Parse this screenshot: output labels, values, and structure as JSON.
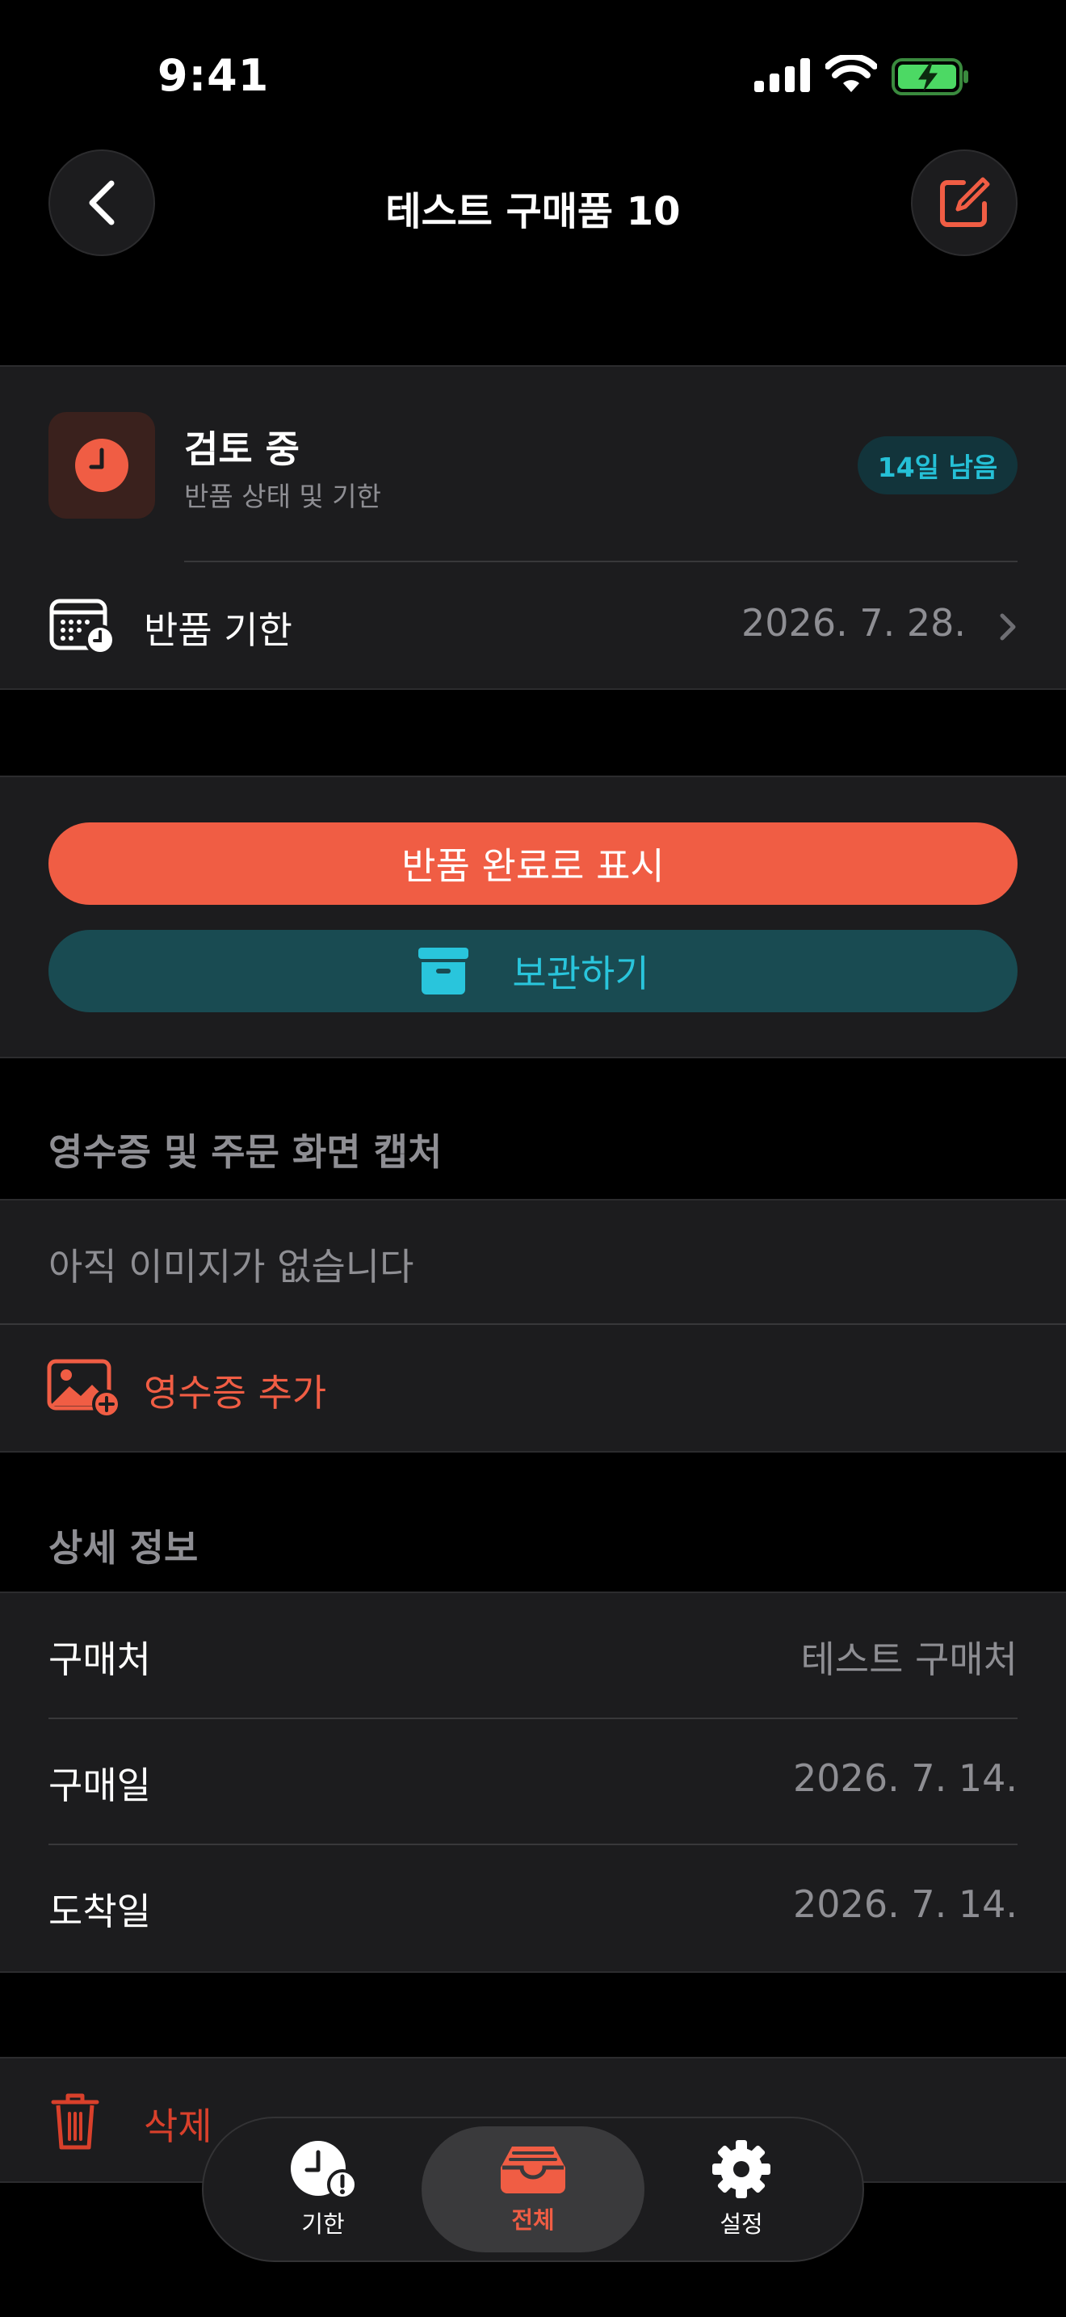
{
  "status_bar": {
    "time": "9:41"
  },
  "nav": {
    "title": "테스트 구매품 10"
  },
  "status_card": {
    "title": "검토 중",
    "subtitle": "반품 상태 및 기한",
    "badge": "14일 남음",
    "deadline_label": "반품 기한",
    "deadline_value": "2026. 7. 28."
  },
  "actions": {
    "complete_label": "반품 완료로 표시",
    "archive_label": "보관하기"
  },
  "receipts": {
    "header": "영수증 및 주문 화면 캡처",
    "empty_text": "아직 이미지가 없습니다",
    "add_label": "영수증 추가"
  },
  "details": {
    "header": "상세 정보",
    "rows": [
      {
        "label": "구매처",
        "value": "테스트 구매처"
      },
      {
        "label": "구매일",
        "value": "2026. 7. 14."
      },
      {
        "label": "도착일",
        "value": "2026. 7. 14."
      }
    ]
  },
  "delete": {
    "label": "삭제"
  },
  "tabbar": {
    "tabs": [
      {
        "label": "기한",
        "active": false
      },
      {
        "label": "전체",
        "active": true
      },
      {
        "label": "설정",
        "active": false
      }
    ]
  },
  "colors": {
    "accent": "#f05d44",
    "teal": "#29c5dc",
    "teal_bg": "#194b52",
    "card": "#1c1c1e",
    "secondary_text": "#8e8e93",
    "danger": "#d9402b"
  }
}
